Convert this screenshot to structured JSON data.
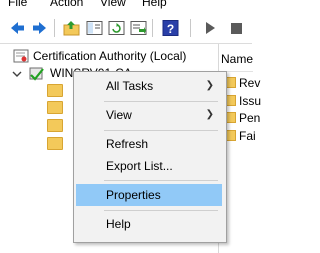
{
  "menubar": {
    "items": [
      "File",
      "Action",
      "View",
      "Help"
    ]
  },
  "tree": {
    "root_label": "Certification Authority (Local)",
    "ca_node_label": "WINSRV01-CA",
    "folder_count": 4
  },
  "right_pane": {
    "header": "Name",
    "rows": [
      "Rev",
      "Issu",
      "Pen",
      "Fai"
    ]
  },
  "context_menu": {
    "all_tasks": "All Tasks",
    "view": "View",
    "refresh": "Refresh",
    "export_list": "Export List...",
    "properties": "Properties",
    "help": "Help",
    "submenu_arrow": "❯",
    "highlighted_item": "Properties",
    "highlight_color": "#91c9f7"
  },
  "colors": {
    "folder": "#f3c95a",
    "selection": "#2a7ad6",
    "menu_background": "#f2f2f2"
  },
  "icons": [
    "back-arrow-icon",
    "forward-arrow-icon",
    "up-folder-icon",
    "show-hide-tree-icon",
    "refresh-icon",
    "export-icon",
    "help-icon",
    "start-service-icon",
    "stop-service-icon"
  ]
}
